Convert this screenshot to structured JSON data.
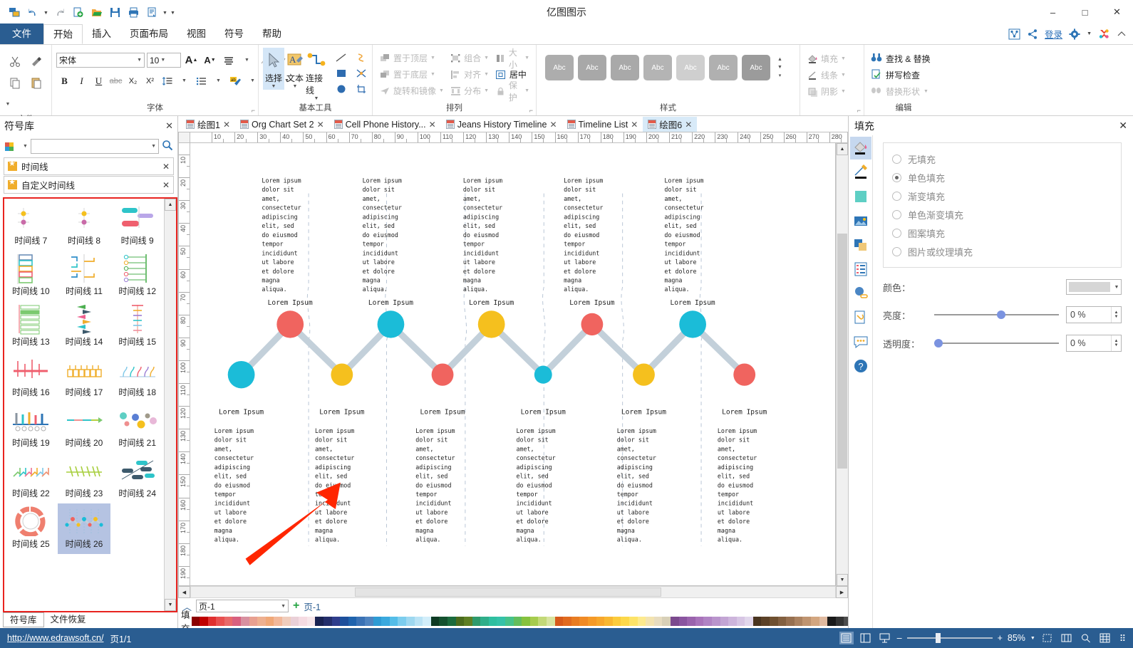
{
  "window": {
    "title": "亿图图示",
    "minimize": "–",
    "maximize": "□",
    "close": "✕"
  },
  "quick_access": [
    {
      "name": "new-window-icon",
      "glyph": "▤"
    },
    {
      "name": "undo-icon",
      "glyph": "↶"
    },
    {
      "name": "redo-icon",
      "glyph": "↷"
    },
    {
      "name": "new-file-icon",
      "glyph": "🗎"
    },
    {
      "name": "open-file-icon",
      "glyph": "📂"
    },
    {
      "name": "save-icon",
      "glyph": "💾"
    },
    {
      "name": "print-icon",
      "glyph": "🖨"
    },
    {
      "name": "export-icon",
      "glyph": "📋"
    }
  ],
  "menu": {
    "tabs": [
      {
        "label": "文件",
        "state": "file"
      },
      {
        "label": "开始",
        "state": "active"
      },
      {
        "label": "插入",
        "state": ""
      },
      {
        "label": "页面布局",
        "state": ""
      },
      {
        "label": "视图",
        "state": ""
      },
      {
        "label": "符号",
        "state": ""
      },
      {
        "label": "帮助",
        "state": ""
      }
    ],
    "right": {
      "login": "登录"
    }
  },
  "ribbon": {
    "groups": [
      {
        "title": "文件"
      },
      {
        "title": "字体"
      },
      {
        "title": "基本工具"
      },
      {
        "title": "排列"
      },
      {
        "title": "样式"
      },
      {
        "title": "编辑"
      }
    ],
    "font": {
      "family": "宋体",
      "size": "10",
      "bold": "B",
      "italic": "I",
      "underline": "U",
      "strike": "abc",
      "subscript": "X₂",
      "superscript": "X²",
      "grow": "A",
      "shrink": "A"
    },
    "tools": [
      {
        "label": "选择",
        "name": "select-tool"
      },
      {
        "label": "文本",
        "name": "text-tool"
      },
      {
        "label": "连接线",
        "name": "connector-tool"
      }
    ],
    "arrange": [
      {
        "label": "置于顶层",
        "enabled": false,
        "arrow": true
      },
      {
        "label": "置于底层",
        "enabled": false,
        "arrow": true
      },
      {
        "label": "旋转和镜像",
        "enabled": false,
        "arrow": true
      },
      {
        "label": "组合",
        "enabled": false,
        "arrow": true
      },
      {
        "label": "对齐",
        "enabled": false,
        "arrow": true
      },
      {
        "label": "分布",
        "enabled": false,
        "arrow": true
      },
      {
        "label": "大小",
        "enabled": false,
        "arrow": true
      },
      {
        "label": "居中",
        "enabled": true,
        "arrow": false
      },
      {
        "label": "保护",
        "enabled": false,
        "arrow": true
      }
    ],
    "style_gallery": {
      "sample_text": "Abc",
      "boxes": [
        "#adadad",
        "#a8a8a8",
        "#a9a9a9",
        "#b4b4b4",
        "#cfcfcf",
        "#b0b0b0",
        "#9b9b9b"
      ]
    },
    "format": [
      {
        "label": "填充",
        "name": "fill-button"
      },
      {
        "label": "线条",
        "name": "line-button"
      },
      {
        "label": "阴影",
        "name": "shadow-button"
      }
    ],
    "edit": [
      {
        "label": "查找 & 替换",
        "enabled": true
      },
      {
        "label": "拼写检查",
        "enabled": true
      },
      {
        "label": "替换形状",
        "enabled": false
      }
    ]
  },
  "left_panel": {
    "title": "符号库",
    "search_placeholder": "",
    "libraries": [
      {
        "label": "时间线"
      },
      {
        "label": "自定义时间线"
      }
    ],
    "shapes": [
      {
        "label": "时间线 7",
        "kind": "axis-dots"
      },
      {
        "label": "时间线 8",
        "kind": "axis-dots"
      },
      {
        "label": "时间线 9",
        "kind": "bars-h"
      },
      {
        "label": "时间线 10",
        "kind": "boxes-v"
      },
      {
        "label": "时间线 11",
        "kind": "steps"
      },
      {
        "label": "时间线 12",
        "kind": "arrows-v"
      },
      {
        "label": "时间线 13",
        "kind": "bars-green"
      },
      {
        "label": "时间线 14",
        "kind": "flags-v"
      },
      {
        "label": "时间线 15",
        "kind": "ticks-v"
      },
      {
        "label": "时间线 16",
        "kind": "comb"
      },
      {
        "label": "时间线 17",
        "kind": "boxes-row"
      },
      {
        "label": "时间线 18",
        "kind": "hooks"
      },
      {
        "label": "时间线 19",
        "kind": "bars-c"
      },
      {
        "label": "时间线 20",
        "kind": "arrow-line"
      },
      {
        "label": "时间线 21",
        "kind": "dots"
      },
      {
        "label": "时间线 22",
        "kind": "zigzag"
      },
      {
        "label": "时间线 23",
        "kind": "fish"
      },
      {
        "label": "时间线 24",
        "kind": "fishbone"
      },
      {
        "label": "时间线 25",
        "kind": "donut"
      },
      {
        "label": "时间线 26",
        "kind": "dotline",
        "selected": true
      }
    ],
    "tabs": [
      {
        "label": "符号库",
        "active": true
      },
      {
        "label": "文件恢复",
        "active": false
      }
    ]
  },
  "document_tabs": [
    {
      "label": "绘图1",
      "active": false
    },
    {
      "label": "Org Chart Set 2",
      "active": false
    },
    {
      "label": "Cell Phone History...",
      "active": false
    },
    {
      "label": "Jeans History Timeline",
      "active": false
    },
    {
      "label": "Timeline List",
      "active": false
    },
    {
      "label": "绘图6",
      "active": true
    }
  ],
  "rulers": {
    "horizontal_labels": [
      "10",
      "20",
      "30",
      "40",
      "50",
      "60",
      "70",
      "80",
      "90",
      "100",
      "110",
      "120",
      "130",
      "140",
      "150",
      "160",
      "170",
      "180",
      "190",
      "200",
      "210",
      "220",
      "230",
      "240",
      "250",
      "260",
      "270",
      "280"
    ],
    "vertical_labels": [
      "10",
      "20",
      "30",
      "40",
      "50",
      "60",
      "70",
      "80",
      "90",
      "100",
      "110",
      "120",
      "130",
      "140",
      "150",
      "160",
      "170",
      "180",
      "190"
    ]
  },
  "canvas": {
    "heading": "Lorem Ipsum",
    "body": "Lorem ipsum dolor sit amet, consectetur adipiscing elit, sed do eiusmod tempor incididunt ut labore et dolore magna aliqua.",
    "body_lines": [
      "Lorem ipsum",
      "dolor sit",
      "amet,",
      "consectetur",
      "adipiscing",
      "elit, sed",
      "do eiusmod",
      "tempor",
      "incididunt",
      "ut labore",
      "et dolore",
      "magna",
      "aliqua."
    ],
    "colors": {
      "cyan": "#1BBCD8",
      "red": "#F0645F",
      "yellow": "#F5C01E",
      "connector": "#C3D0DA",
      "divider": "#b9c6d6",
      "arrow": "#FF2600"
    },
    "nodes": [
      {
        "index": 0,
        "color": "cyan",
        "size": "large",
        "position": "low"
      },
      {
        "index": 1,
        "color": "red",
        "size": "large",
        "position": "high"
      },
      {
        "index": 2,
        "color": "yellow",
        "size": "medium",
        "position": "low"
      },
      {
        "index": 3,
        "color": "cyan",
        "size": "large",
        "position": "high"
      },
      {
        "index": 4,
        "color": "red",
        "size": "medium",
        "position": "low"
      },
      {
        "index": 5,
        "color": "yellow",
        "size": "large",
        "position": "high"
      },
      {
        "index": 6,
        "color": "cyan",
        "size": "small",
        "position": "low"
      },
      {
        "index": 7,
        "color": "red",
        "size": "medium",
        "position": "high"
      },
      {
        "index": 8,
        "color": "yellow",
        "size": "medium",
        "position": "low"
      },
      {
        "index": 9,
        "color": "cyan",
        "size": "large",
        "position": "high"
      },
      {
        "index": 10,
        "color": "red",
        "size": "medium",
        "position": "low"
      }
    ],
    "top_blocks": 5,
    "bottom_blocks": 6
  },
  "page_bar": {
    "page_select_value": "页-1",
    "add_page": "+",
    "page_tab": "页-1",
    "fill_label": "填充"
  },
  "right_panel": {
    "title": "填充",
    "fill_options": [
      {
        "label": "无填充",
        "selected": false
      },
      {
        "label": "单色填充",
        "selected": true
      },
      {
        "label": "渐变填充",
        "selected": false
      },
      {
        "label": "单色渐变填充",
        "selected": false
      },
      {
        "label": "图案填充",
        "selected": false
      },
      {
        "label": "图片或纹理填充",
        "selected": false
      }
    ],
    "properties": [
      {
        "label": "颜色：",
        "type": "color",
        "value": ""
      },
      {
        "label": "亮度：",
        "type": "slider",
        "value": "0 %",
        "pct": 50
      },
      {
        "label": "透明度：",
        "type": "slider",
        "value": "0 %",
        "pct": 0
      }
    ],
    "side_icons": [
      {
        "name": "fill-icon",
        "selected": true
      },
      {
        "name": "line-pen-icon",
        "selected": false
      },
      {
        "name": "color-swatch-icon",
        "selected": false
      },
      {
        "name": "image-icon",
        "selected": false
      },
      {
        "name": "shadow-icon",
        "selected": false
      },
      {
        "name": "list-properties-icon",
        "selected": false
      },
      {
        "name": "hyperlink-icon",
        "selected": false
      },
      {
        "name": "attachment-icon",
        "selected": false
      },
      {
        "name": "comment-icon",
        "selected": false
      },
      {
        "name": "help-icon",
        "selected": false
      }
    ]
  },
  "status_bar": {
    "url": "http://www.edrawsoft.cn/",
    "page_count": "页1/1",
    "zoom_level": "85%",
    "zoom_out": "–",
    "zoom_in": "+"
  }
}
